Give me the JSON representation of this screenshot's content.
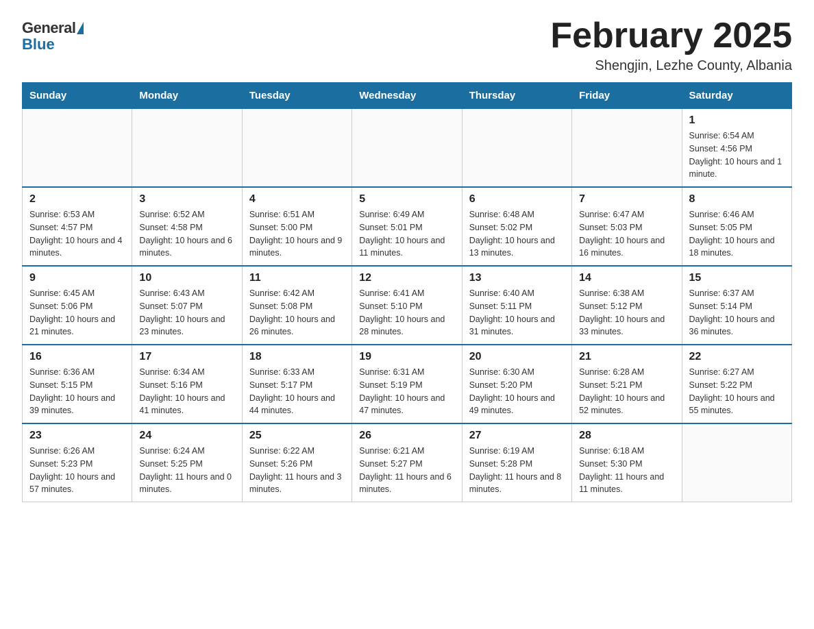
{
  "logo": {
    "general": "General",
    "blue": "Blue"
  },
  "title": "February 2025",
  "location": "Shengjin, Lezhe County, Albania",
  "days_of_week": [
    "Sunday",
    "Monday",
    "Tuesday",
    "Wednesday",
    "Thursday",
    "Friday",
    "Saturday"
  ],
  "weeks": [
    [
      {
        "day": "",
        "info": ""
      },
      {
        "day": "",
        "info": ""
      },
      {
        "day": "",
        "info": ""
      },
      {
        "day": "",
        "info": ""
      },
      {
        "day": "",
        "info": ""
      },
      {
        "day": "",
        "info": ""
      },
      {
        "day": "1",
        "info": "Sunrise: 6:54 AM\nSunset: 4:56 PM\nDaylight: 10 hours and 1 minute."
      }
    ],
    [
      {
        "day": "2",
        "info": "Sunrise: 6:53 AM\nSunset: 4:57 PM\nDaylight: 10 hours and 4 minutes."
      },
      {
        "day": "3",
        "info": "Sunrise: 6:52 AM\nSunset: 4:58 PM\nDaylight: 10 hours and 6 minutes."
      },
      {
        "day": "4",
        "info": "Sunrise: 6:51 AM\nSunset: 5:00 PM\nDaylight: 10 hours and 9 minutes."
      },
      {
        "day": "5",
        "info": "Sunrise: 6:49 AM\nSunset: 5:01 PM\nDaylight: 10 hours and 11 minutes."
      },
      {
        "day": "6",
        "info": "Sunrise: 6:48 AM\nSunset: 5:02 PM\nDaylight: 10 hours and 13 minutes."
      },
      {
        "day": "7",
        "info": "Sunrise: 6:47 AM\nSunset: 5:03 PM\nDaylight: 10 hours and 16 minutes."
      },
      {
        "day": "8",
        "info": "Sunrise: 6:46 AM\nSunset: 5:05 PM\nDaylight: 10 hours and 18 minutes."
      }
    ],
    [
      {
        "day": "9",
        "info": "Sunrise: 6:45 AM\nSunset: 5:06 PM\nDaylight: 10 hours and 21 minutes."
      },
      {
        "day": "10",
        "info": "Sunrise: 6:43 AM\nSunset: 5:07 PM\nDaylight: 10 hours and 23 minutes."
      },
      {
        "day": "11",
        "info": "Sunrise: 6:42 AM\nSunset: 5:08 PM\nDaylight: 10 hours and 26 minutes."
      },
      {
        "day": "12",
        "info": "Sunrise: 6:41 AM\nSunset: 5:10 PM\nDaylight: 10 hours and 28 minutes."
      },
      {
        "day": "13",
        "info": "Sunrise: 6:40 AM\nSunset: 5:11 PM\nDaylight: 10 hours and 31 minutes."
      },
      {
        "day": "14",
        "info": "Sunrise: 6:38 AM\nSunset: 5:12 PM\nDaylight: 10 hours and 33 minutes."
      },
      {
        "day": "15",
        "info": "Sunrise: 6:37 AM\nSunset: 5:14 PM\nDaylight: 10 hours and 36 minutes."
      }
    ],
    [
      {
        "day": "16",
        "info": "Sunrise: 6:36 AM\nSunset: 5:15 PM\nDaylight: 10 hours and 39 minutes."
      },
      {
        "day": "17",
        "info": "Sunrise: 6:34 AM\nSunset: 5:16 PM\nDaylight: 10 hours and 41 minutes."
      },
      {
        "day": "18",
        "info": "Sunrise: 6:33 AM\nSunset: 5:17 PM\nDaylight: 10 hours and 44 minutes."
      },
      {
        "day": "19",
        "info": "Sunrise: 6:31 AM\nSunset: 5:19 PM\nDaylight: 10 hours and 47 minutes."
      },
      {
        "day": "20",
        "info": "Sunrise: 6:30 AM\nSunset: 5:20 PM\nDaylight: 10 hours and 49 minutes."
      },
      {
        "day": "21",
        "info": "Sunrise: 6:28 AM\nSunset: 5:21 PM\nDaylight: 10 hours and 52 minutes."
      },
      {
        "day": "22",
        "info": "Sunrise: 6:27 AM\nSunset: 5:22 PM\nDaylight: 10 hours and 55 minutes."
      }
    ],
    [
      {
        "day": "23",
        "info": "Sunrise: 6:26 AM\nSunset: 5:23 PM\nDaylight: 10 hours and 57 minutes."
      },
      {
        "day": "24",
        "info": "Sunrise: 6:24 AM\nSunset: 5:25 PM\nDaylight: 11 hours and 0 minutes."
      },
      {
        "day": "25",
        "info": "Sunrise: 6:22 AM\nSunset: 5:26 PM\nDaylight: 11 hours and 3 minutes."
      },
      {
        "day": "26",
        "info": "Sunrise: 6:21 AM\nSunset: 5:27 PM\nDaylight: 11 hours and 6 minutes."
      },
      {
        "day": "27",
        "info": "Sunrise: 6:19 AM\nSunset: 5:28 PM\nDaylight: 11 hours and 8 minutes."
      },
      {
        "day": "28",
        "info": "Sunrise: 6:18 AM\nSunset: 5:30 PM\nDaylight: 11 hours and 11 minutes."
      },
      {
        "day": "",
        "info": ""
      }
    ]
  ]
}
